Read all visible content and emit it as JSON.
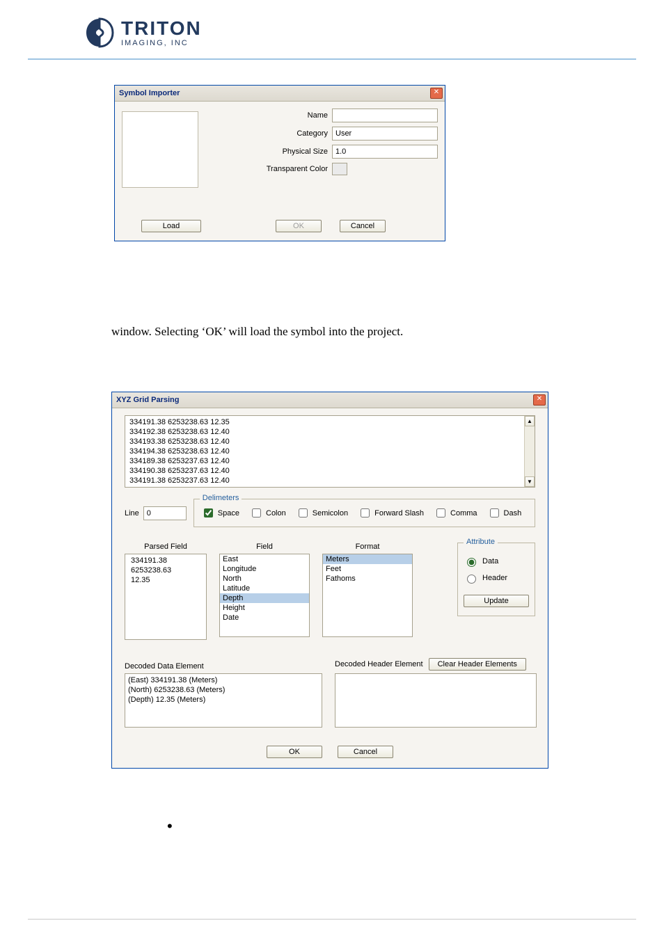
{
  "header": {
    "brand": "TRITON",
    "tagline": "IMAGING, INC"
  },
  "symbolImporter": {
    "title": "Symbol Importer",
    "labels": {
      "name": "Name",
      "category": "Category",
      "physicalSize": "Physical Size",
      "transparentColor": "Transparent Color"
    },
    "fields": {
      "name": "",
      "category": "User",
      "physicalSize": "1.0"
    },
    "buttons": {
      "load": "Load",
      "ok": "OK",
      "cancel": "Cancel"
    }
  },
  "bodyText": "window.  Selecting ‘OK’ will load the symbol into the project.",
  "xyz": {
    "title": "XYZ Grid Parsing",
    "rawLines": [
      "334191.38 6253238.63 12.35",
      "334192.38 6253238.63 12.40",
      "334193.38 6253238.63 12.40",
      "334194.38 6253238.63 12.40",
      "334189.38 6253237.63 12.40",
      "334190.38 6253237.63 12.40",
      "334191.38 6253237.63 12.40"
    ],
    "lineLabel": "Line",
    "lineValue": "0",
    "delimiters": {
      "groupTitle": "Delimeters",
      "options": [
        {
          "key": "space",
          "label": "Space",
          "checked": true
        },
        {
          "key": "colon",
          "label": "Colon",
          "checked": false
        },
        {
          "key": "semicolon",
          "label": "Semicolon",
          "checked": false
        },
        {
          "key": "forwardSlash",
          "label": "Forward Slash",
          "checked": false
        },
        {
          "key": "comma",
          "label": "Comma",
          "checked": false
        },
        {
          "key": "dash",
          "label": "Dash",
          "checked": false
        }
      ]
    },
    "columns": {
      "parsedHeader": "Parsed Field",
      "parsed": [
        "334191.38",
        "6253238.63",
        "12.35"
      ],
      "fieldHeader": "Field",
      "fields": [
        {
          "label": "East",
          "selected": false
        },
        {
          "label": "Longitude",
          "selected": false
        },
        {
          "label": "North",
          "selected": false
        },
        {
          "label": "Latitude",
          "selected": false
        },
        {
          "label": "Depth",
          "selected": true
        },
        {
          "label": "Height",
          "selected": false
        },
        {
          "label": "Date",
          "selected": false
        }
      ],
      "formatHeader": "Format",
      "formats": [
        {
          "label": "Meters",
          "selected": true
        },
        {
          "label": "Feet",
          "selected": false
        },
        {
          "label": "Fathoms",
          "selected": false
        }
      ]
    },
    "attribute": {
      "groupTitle": "Attribute",
      "dataLabel": "Data",
      "headerLabel": "Header",
      "selected": "data",
      "updateLabel": "Update"
    },
    "decoded": {
      "dataHeader": "Decoded Data Element",
      "dataLines": [
        "(East) 334191.38 (Meters)",
        "(North) 6253238.63 (Meters)",
        "(Depth) 12.35 (Meters)"
      ],
      "headerHeader": "Decoded Header Element",
      "clearLabel": "Clear Header Elements"
    },
    "buttons": {
      "ok": "OK",
      "cancel": "Cancel"
    }
  },
  "bullet": "•"
}
